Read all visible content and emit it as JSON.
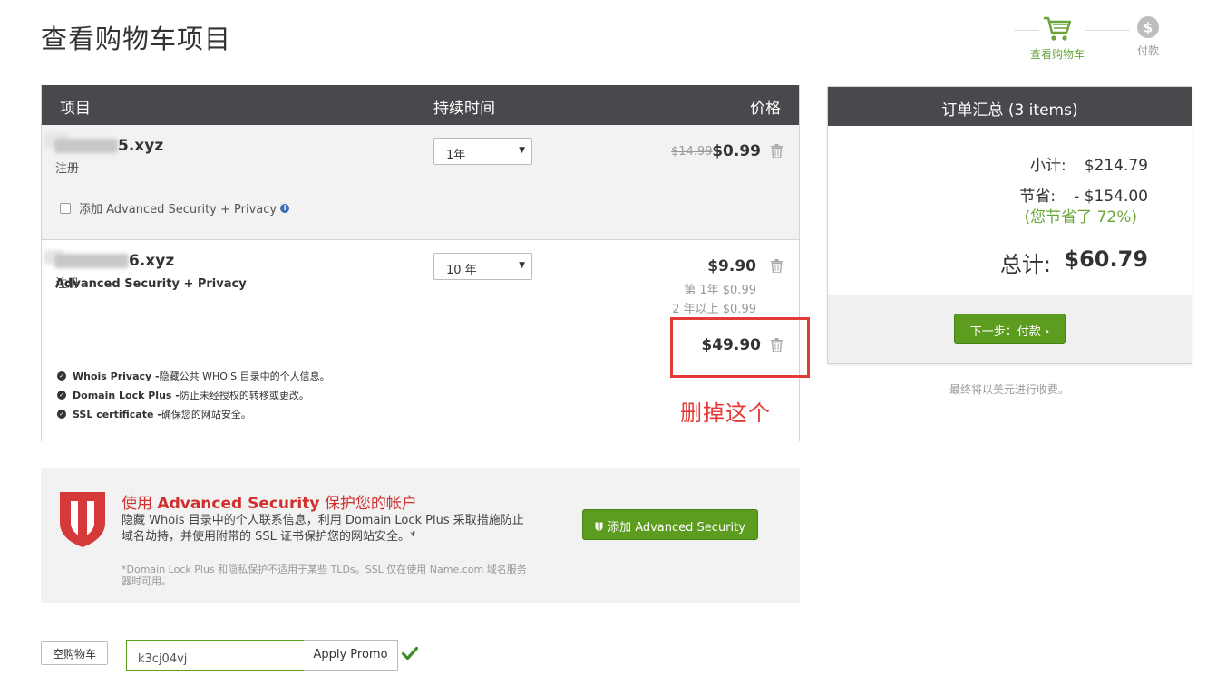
{
  "page_title": "查看购物车项目",
  "steps": [
    {
      "label": "查看购物车",
      "state": "active"
    },
    {
      "label": "付款",
      "state": "inactive"
    }
  ],
  "cart": {
    "headers": {
      "item": "项目",
      "duration": "持续时间",
      "price": "价格"
    },
    "items": [
      {
        "domain": "5.xyz",
        "type": "注册",
        "duration": "1年",
        "old_price": "$14.99",
        "price": "$0.99",
        "addon_label": "添加 Advanced Security + Privacy"
      },
      {
        "domain": "6.xyz",
        "type": "注册",
        "duration": "10 年",
        "price": "$9.90",
        "first_year": "第 1年 $0.99",
        "later_years": "2 年以上 $0.99",
        "addon": {
          "title": "Advanced Security + Privacy",
          "price": "$49.90",
          "features": [
            {
              "name": "Whois Privacy -",
              "desc": " 隐藏公共 WHOIS 目录中的个人信息。"
            },
            {
              "name": "Domain Lock Plus -",
              "desc": " 防止未经授权的转移或更改。"
            },
            {
              "name": "SSL certificate -",
              "desc": " 确保您的网站安全。"
            }
          ]
        }
      }
    ]
  },
  "annotation": {
    "text": "删掉这个",
    "color": "#e53935"
  },
  "summary": {
    "title": "订单汇总 (3 items)",
    "subtotal_label": "小计:",
    "subtotal": "$214.79",
    "savings_label": "节省:",
    "savings": "- $154.00",
    "saved_pct": "(您节省了 72%)",
    "total_label": "总计:",
    "total": "$60.79",
    "next_button": "下一步：付款",
    "note": "最终将以美元进行收费。"
  },
  "promo": {
    "title_prefix": "使用 ",
    "title_bold": "Advanced Security",
    "title_suffix": " 保护您的帐户",
    "description": "隐藏 Whois 目录中的个人联系信息，利用 Domain Lock Plus 采取措施防止域名劫持，并使用附带的 SSL 证书保护您的网站安全。*",
    "fine_print_1": "*Domain Lock Plus 和隐私保护不适用于",
    "fine_print_link": "某些 TLDs",
    "fine_print_2": "。SSL 仅在使用 Name.com 域名服务器时可用。",
    "button": "添加 Advanced Security"
  },
  "bottom": {
    "empty_cart": "空购物车",
    "promo_code": "k3cj04vj",
    "apply": "Apply Promo"
  },
  "colors": {
    "header": "#47494c",
    "accent_green": "#5c9c1f",
    "savings_green": "#6aa53a",
    "alert_red": "#e53935",
    "promo_red": "#d0302d"
  }
}
